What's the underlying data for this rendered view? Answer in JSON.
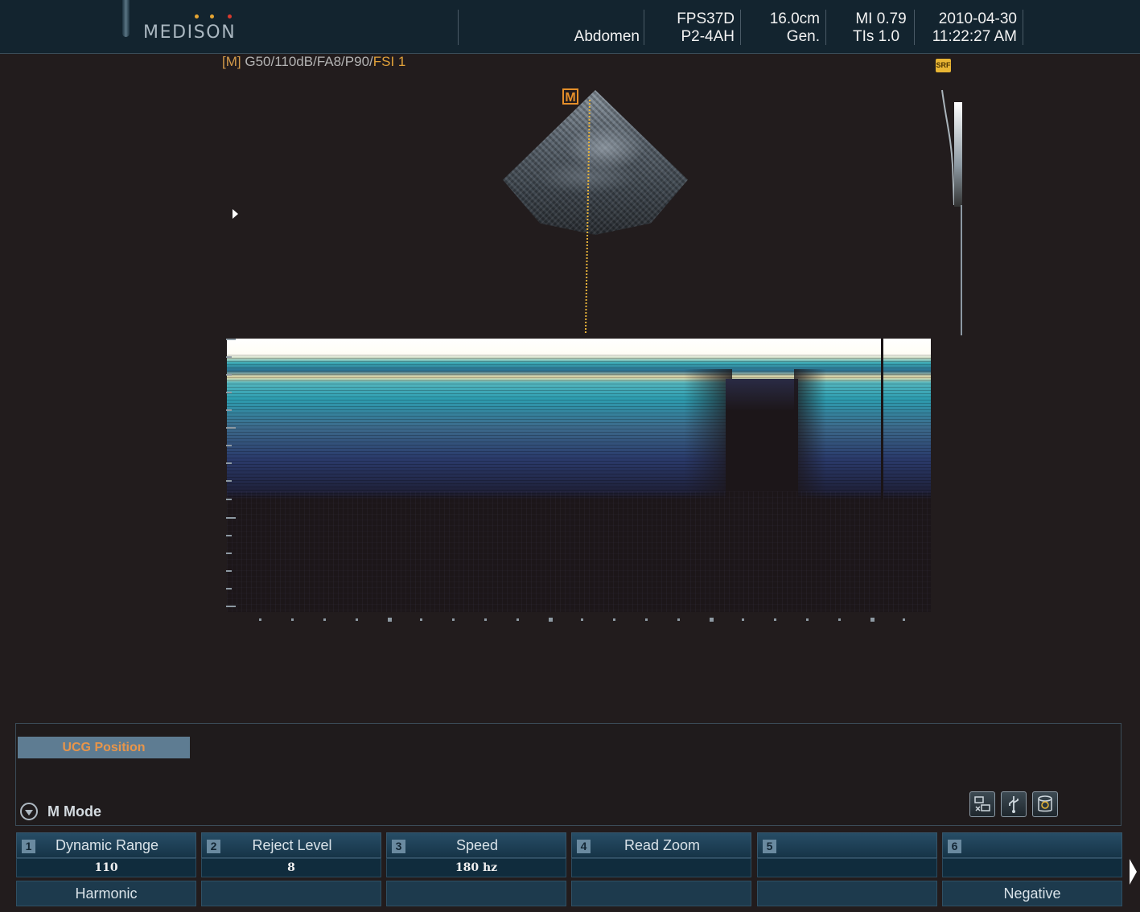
{
  "header": {
    "logo_text": "MEDISON",
    "logo_dot_colors": [
      "#e6a532",
      "#e6a532",
      "#d93a2e"
    ],
    "application": "Abdomen",
    "probe": "FPS37D",
    "preset": "P2-4AH",
    "depth": "16.0cm",
    "frequency_mode": "Gen.",
    "mi": "MI 0.79",
    "tis": "TIs 1.0",
    "date": "2010-04-30",
    "time": "11:22:27 AM"
  },
  "params": {
    "mode_tag": "[M]",
    "settings": "G50/110dB/FA8/P90/",
    "fsi": "FSI 1"
  },
  "image": {
    "m_marker": "M",
    "saf_icon": "SRF"
  },
  "panel": {
    "ucg_button": "UCG Position",
    "mode_label": "M Mode",
    "tools": [
      "network-icon",
      "usb-icon",
      "disk-icon"
    ]
  },
  "softkeys": [
    {
      "num": "1",
      "label": "Dynamic Range",
      "value": "110",
      "bottom": "Harmonic"
    },
    {
      "num": "2",
      "label": "Reject Level",
      "value": "8",
      "bottom": ""
    },
    {
      "num": "3",
      "label": "Speed",
      "value": "180 hz",
      "bottom": ""
    },
    {
      "num": "4",
      "label": "Read Zoom",
      "value": "",
      "bottom": ""
    },
    {
      "num": "5",
      "label": "",
      "value": "",
      "bottom": ""
    },
    {
      "num": "6",
      "label": "",
      "value": "",
      "bottom": "Negative"
    }
  ],
  "colors": {
    "header_bg": "#13242f",
    "accent_orange": "#e58f2a",
    "softkey_bg": "#1d3a4d"
  }
}
